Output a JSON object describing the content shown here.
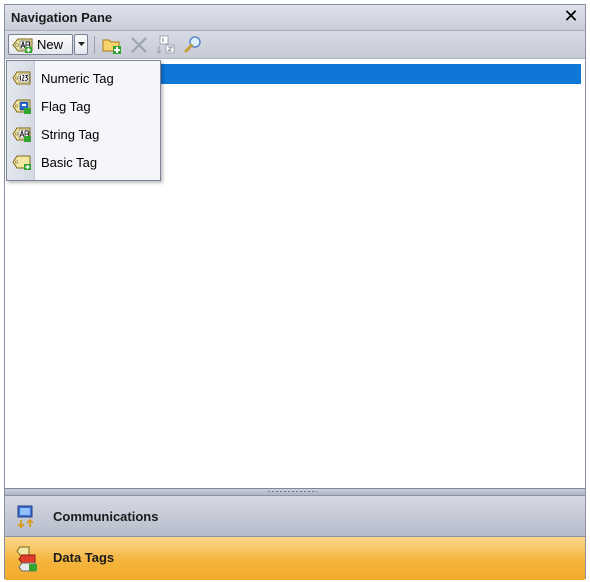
{
  "pane": {
    "title": "Navigation Pane",
    "close_glyph": "✕"
  },
  "toolbar": {
    "new_label": "New",
    "icons": [
      "new-tag-icon",
      "dropdown-arrow-icon",
      "add-folder-icon",
      "delete-icon",
      "sort-icon",
      "search-icon"
    ]
  },
  "new_menu": {
    "items": [
      {
        "label": "Numeric Tag",
        "icon": "numeric-tag-icon"
      },
      {
        "label": "Flag Tag",
        "icon": "flag-tag-icon"
      },
      {
        "label": "String Tag",
        "icon": "string-tag-icon"
      },
      {
        "label": "Basic Tag",
        "icon": "basic-tag-icon"
      }
    ]
  },
  "nav_buttons": [
    {
      "label": "Communications",
      "icon": "communications-icon",
      "selected": false
    },
    {
      "label": "Data Tags",
      "icon": "data-tags-icon",
      "selected": true
    }
  ],
  "colors": {
    "selection_blue": "#0f78d7",
    "active_nav_orange": "#f5b53e"
  }
}
